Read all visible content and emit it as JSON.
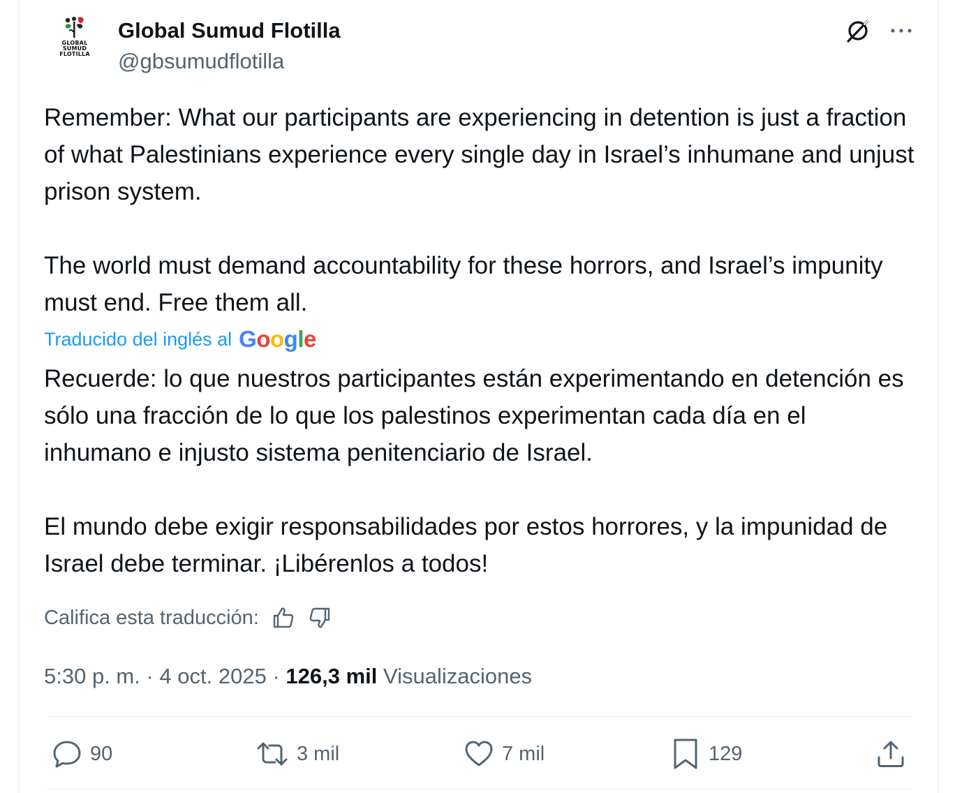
{
  "author": {
    "display_name": "Global Sumud Flotilla",
    "handle": "@gbsumudflotilla",
    "logo_lines": [
      "GLOBAL",
      "SUMUD",
      "FLOTILLA"
    ],
    "avatar_icon": "flotilla-logo-icon"
  },
  "header_actions": {
    "grok_icon": "grok-icon",
    "more_icon": "more-horizontal-icon"
  },
  "tweet": {
    "text": "Remember: What our participants are experiencing in detention is just a fraction of what Palestinians experience every single day in Israel’s inhumane and unjust prison system.\n\nThe world must demand accountability for these horrors, and Israel’s impunity must end. Free them all.",
    "translated_label": "Traducido del inglés al",
    "translator_brand": "Google",
    "translation": "Recuerde: lo que nuestros participantes están experimentando en detención es sólo una fracción de lo que los palestinos experimentan cada día en el inhumano e injusto sistema penitenciario de Israel.\n\nEl mundo debe exigir responsabilidades por estos horrores, y la impunidad de Israel debe terminar. ¡Libérenlos a todos!",
    "rate_label": "Califica esta traducción:"
  },
  "meta": {
    "time": "5:30 p. m.",
    "separator": " · ",
    "date": "4 oct. 2025",
    "views_count": "126,3 mil",
    "views_label": "Visualizaciones"
  },
  "actions": {
    "replies": "90",
    "reposts": "3 mil",
    "likes": "7 mil",
    "bookmarks": "129"
  },
  "colors": {
    "text_primary": "#0f1419",
    "text_secondary": "#536471",
    "link": "#1d9bf0",
    "border": "#eff3f4",
    "google_blue": "#4285F4",
    "google_red": "#EA4335",
    "google_yellow": "#FBBC05",
    "google_green": "#34A853"
  }
}
